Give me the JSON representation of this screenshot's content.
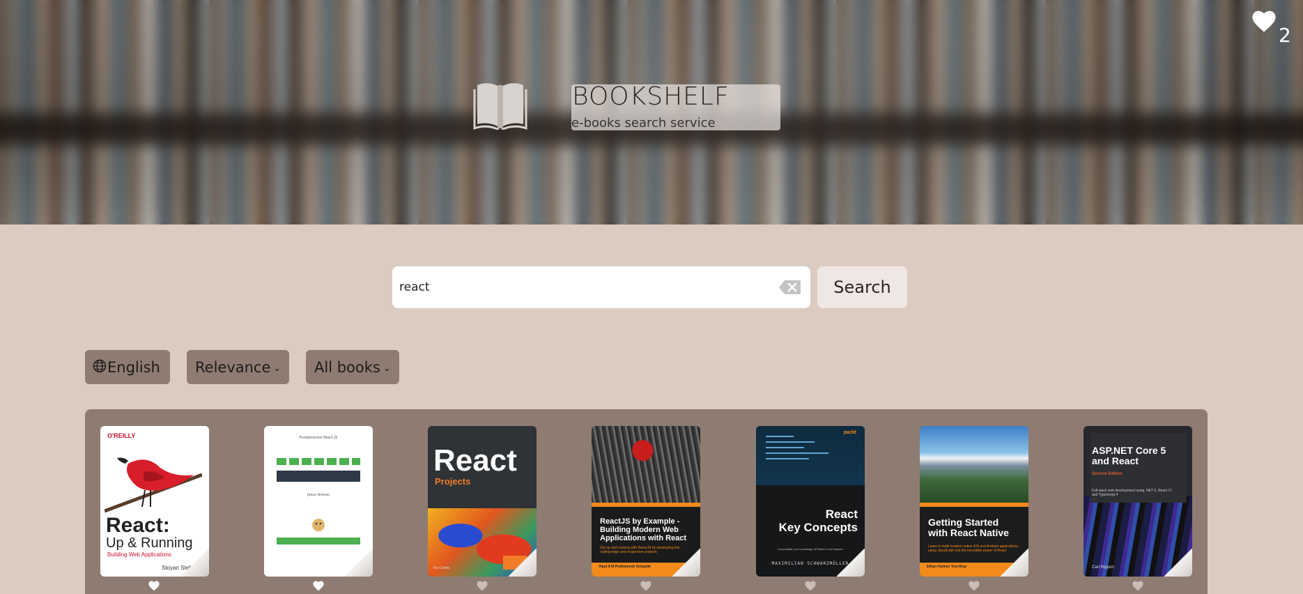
{
  "header": {
    "title": "BOOKSHELF",
    "subtitle": "e-books search service",
    "favorites_count": "2"
  },
  "search": {
    "value": "react",
    "button_label": "Search"
  },
  "filters": {
    "language": "English",
    "sort": "Relevance",
    "type": "All books"
  },
  "books": [
    {
      "publisher": "O'REILLY",
      "title_line1": "React:",
      "title_line2": "Up & Running",
      "subtitle": "Building Web Applications",
      "author": "Stoyan Stefanov"
    },
    {
      "title_line1": "Fundamental React JS",
      "subtitle": "Jesus Arenas"
    },
    {
      "title_line1": "React",
      "title_line2": "Projects",
      "author": "Roy Derks"
    },
    {
      "title_line1": "ReactJS by Example - Building Modern Web Applications with React",
      "subtitle": "Get up and running with ReactJS by developing five cutting-edge and responsive projects",
      "author": "Vipul A M  Prathamesh Sonpatki"
    },
    {
      "publisher": "packt",
      "title_line1": "React",
      "title_line2": "Key Concepts",
      "subtitle": "Consolidate your knowledge of React's core features",
      "author": "MAXIMILIAN SCHWARZMÜLLER"
    },
    {
      "title_line1": "Getting Started with React Native",
      "subtitle": "Learn to build modern native iOS and Android applications using JavaScript and the incredible power of React",
      "author": "Ethan Holmes  Tom Bray"
    },
    {
      "title_line1": "ASP.NET Core 5 and React",
      "title_line2": "Second Edition",
      "subtitle": "Full-stack web development using .NET 5, React 17, and TypeScript 4",
      "author": "Carl Rippon"
    }
  ]
}
